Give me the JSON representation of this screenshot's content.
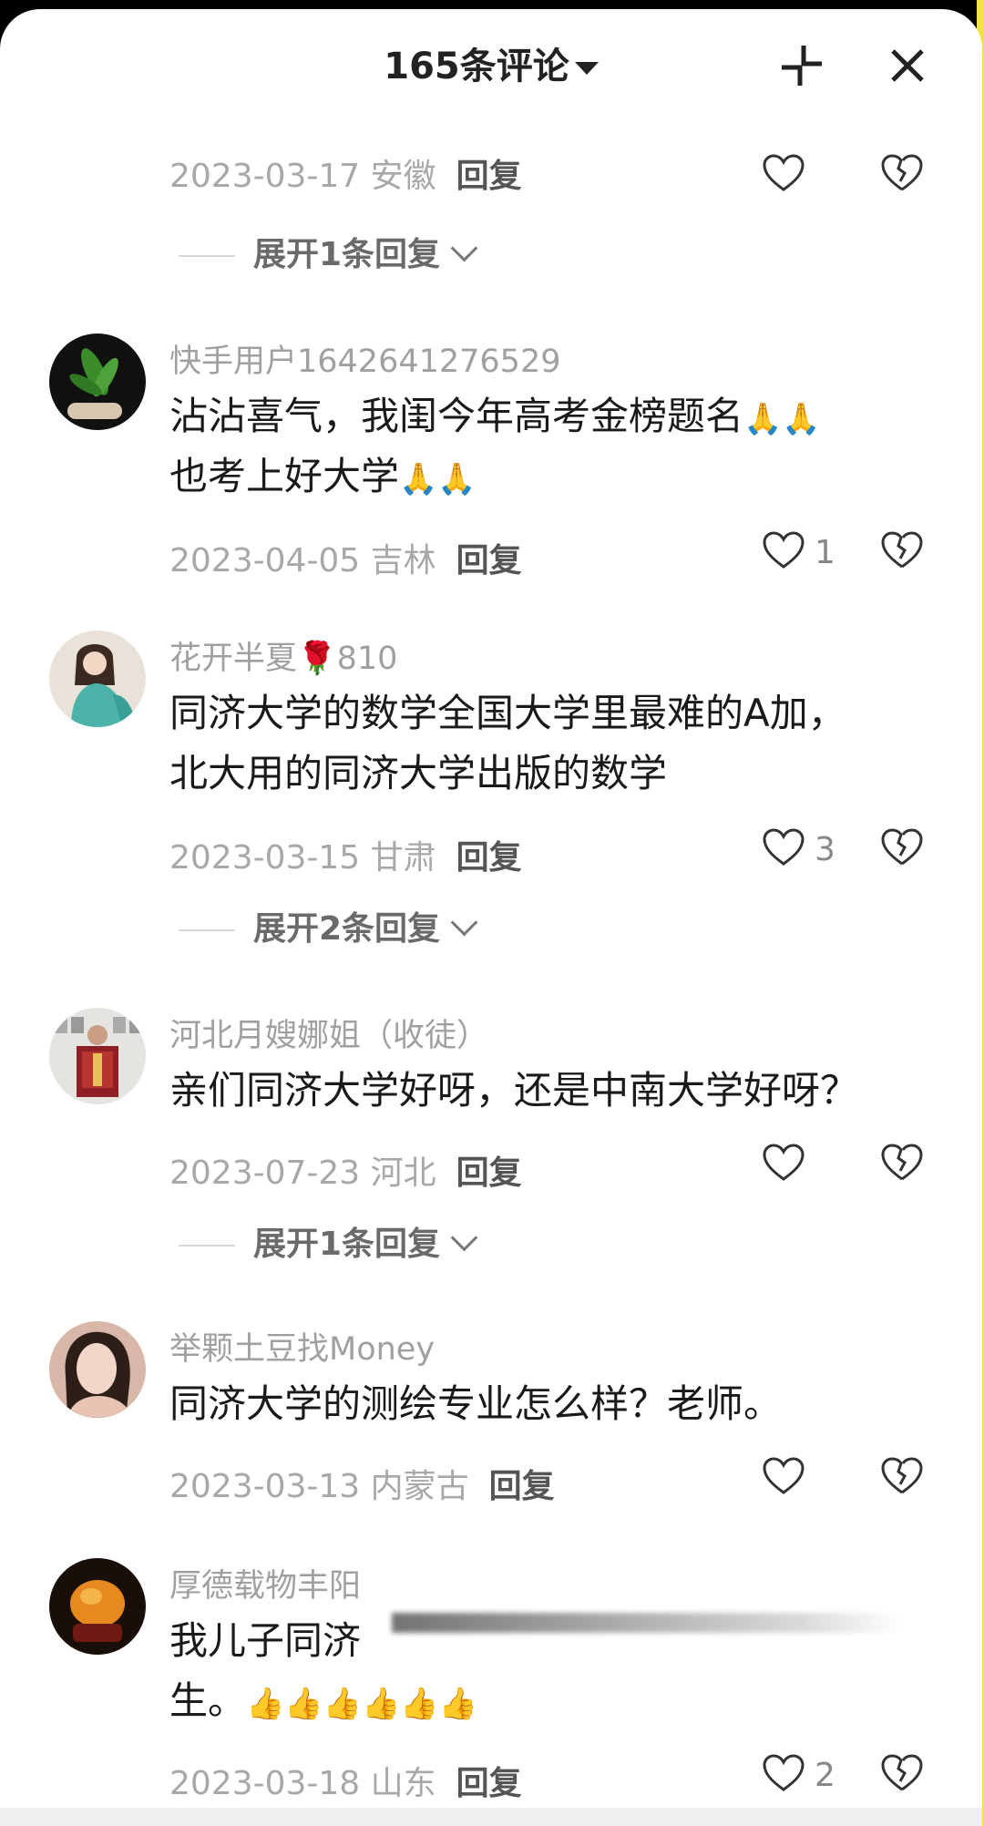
{
  "header": {
    "title": "165条评论"
  },
  "colors": {
    "accent_yellow": "#f2e24a",
    "muted_text": "#a0a0a0",
    "body_text": "#1a1a1a"
  },
  "top_meta": {
    "date_loc": "2023-03-17 安徽",
    "reply": "回复",
    "expand": "展开1条回复"
  },
  "comments": [
    {
      "user": "快手用户1642641276529",
      "line1": "沾沾喜气，我闺今年高考金榜题名",
      "line1_emoji": "🙏🙏",
      "line2": "也考上好大学",
      "line2_emoji": "🙏🙏",
      "date_loc": "2023-04-05 吉林",
      "reply": "回复",
      "likes": "1"
    },
    {
      "user": "花开半夏",
      "user_emoji": "🌹",
      "user_suffix": "810",
      "line1": "同济大学的数学全国大学里最难的A加，",
      "line2": "北大用的同济大学出版的数学",
      "date_loc": "2023-03-15 甘肃",
      "reply": "回复",
      "likes": "3",
      "expand": "展开2条回复"
    },
    {
      "user": "河北月嫂娜姐（收徒）",
      "line1": "亲们同济大学好呀，还是中南大学好呀？",
      "date_loc": "2023-07-23 河北",
      "reply": "回复",
      "expand": "展开1条回复"
    },
    {
      "user": "举颗土豆找Money",
      "line1": "同济大学的测绘专业怎么样？老师。",
      "date_loc": "2023-03-13 内蒙古",
      "reply": "回复"
    },
    {
      "user": "厚德载物丰阳",
      "line1": "我儿子同济",
      "line2": "生。",
      "line2_emoji": "👍👍👍👍👍👍",
      "date_loc": "2023-03-18 山东",
      "reply": "回复",
      "likes": "2"
    }
  ]
}
